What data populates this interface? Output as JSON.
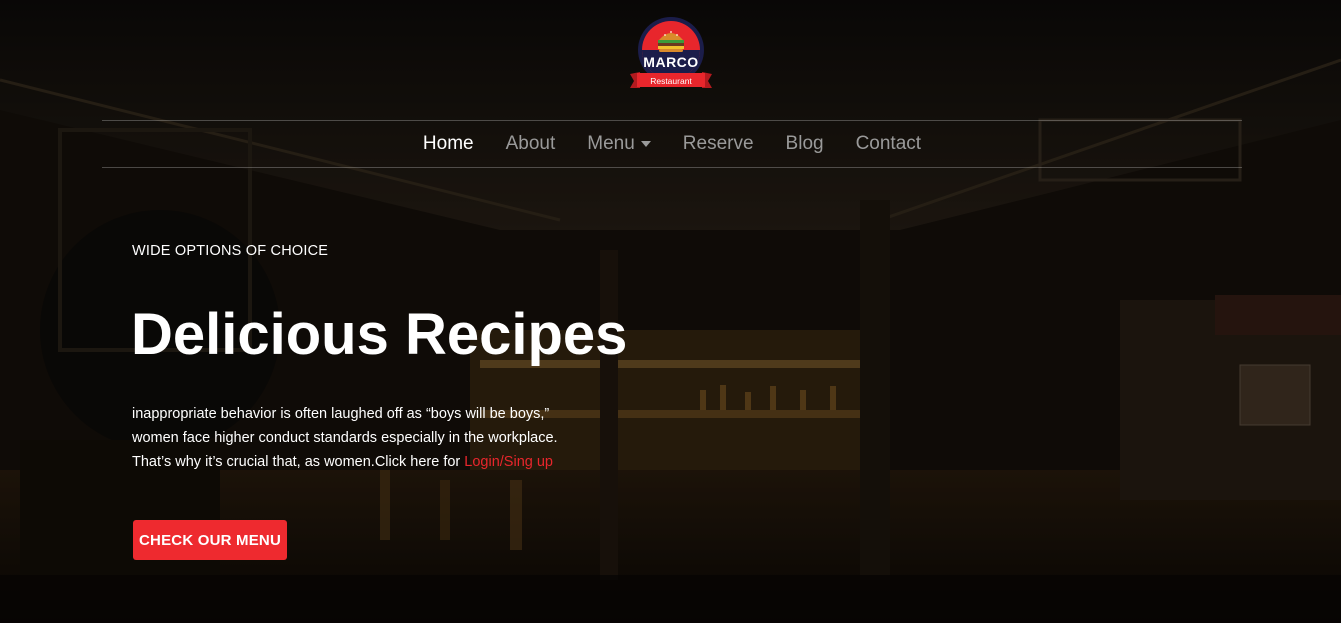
{
  "logo": {
    "name": "MARCO",
    "tagline": "Restaurant"
  },
  "nav": {
    "items": [
      {
        "label": "Home",
        "active": true
      },
      {
        "label": "About"
      },
      {
        "label": "Menu",
        "has_dropdown": true
      },
      {
        "label": "Reserve"
      },
      {
        "label": "Blog"
      },
      {
        "label": "Contact"
      }
    ]
  },
  "hero": {
    "eyebrow": "WIDE OPTIONS OF CHOICE",
    "title": "Delicious Recipes",
    "description_line1": "inappropriate behavior is often laughed off as “boys will be boys,”",
    "description_line2": "women face higher conduct standards especially in the workplace.",
    "description_line3": "That’s why it’s crucial that, as women.Click here for ",
    "link_label": "Login/Sing up",
    "cta_label": "CHECK OUR MENU"
  },
  "colors": {
    "accent": "#ee2a2f",
    "link": "#e8262c",
    "nav_inactive": "#9a9a9a"
  }
}
